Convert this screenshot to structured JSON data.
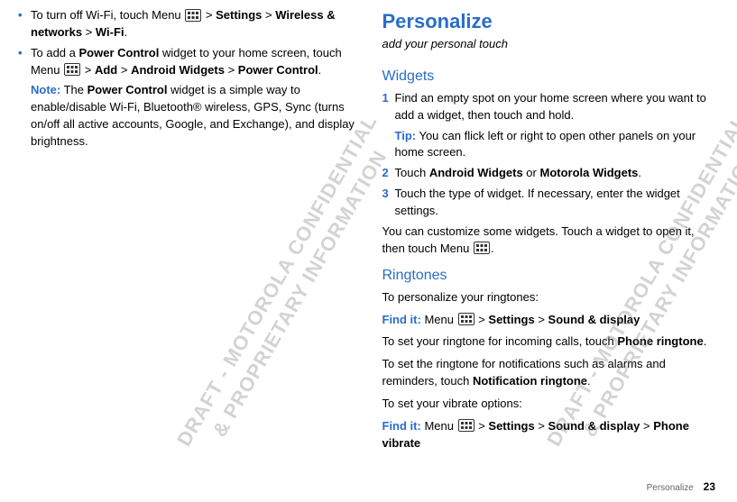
{
  "leftCol": {
    "b1_pre": "To turn off Wi-Fi, touch Menu ",
    "b1_mid1": " > ",
    "b1_s1": "Settings",
    "b1_mid2": " > ",
    "b1_s2": "Wireless & networks",
    "b1_mid3": " > ",
    "b1_s3": "Wi-Fi",
    "b1_post": ".",
    "b2_pre": "To add a ",
    "b2_s1": "Power Control",
    "b2_mid1": " widget to your home screen, touch Menu ",
    "b2_mid2": " > ",
    "b2_s2": "Add",
    "b2_mid3": " > ",
    "b2_s3": "Android Widgets",
    "b2_mid4": " > ",
    "b2_s4": "Power Control",
    "b2_post": ".",
    "noteLabel": "Note:",
    "note_pre": " The ",
    "note_s1": "Power Control",
    "note_post": " widget is a simple way to enable/disable Wi-Fi, Bluetooth® wireless, GPS, Sync (turns on/off all active accounts, Google, and Exchange), and display brightness."
  },
  "rightCol": {
    "title": "Personalize",
    "subtitle": "add your personal touch",
    "widgetsHeading": "Widgets",
    "w1": "Find an empty spot on your home screen where you want to add a widget, then touch and hold.",
    "w1TipLabel": "Tip:",
    "w1Tip": " You can flick left or right to open other panels on your home screen.",
    "w2_pre": "Touch ",
    "w2_s1": "Android Widgets",
    "w2_mid": " or ",
    "w2_s2": "Motorola Widgets",
    "w2_post": ".",
    "w3": "Touch the type of widget. If necessary, enter the widget settings.",
    "widgetsTail_pre": "You can customize some widgets. Touch a widget to open it, then touch Menu ",
    "widgetsTail_post": ".",
    "ringHeading": "Ringtones",
    "ringIntro": "To personalize your ringtones:",
    "findItLabel": "Find it:",
    "r1_pre": " Menu ",
    "r1_mid1": " > ",
    "r1_s1": "Settings",
    "r1_mid2": " > ",
    "r1_s2": "Sound & display",
    "r2_pre": "To set your ringtone for incoming calls, touch ",
    "r2_s1": "Phone ringtone",
    "r2_post": ".",
    "r3_pre": "To set the ringtone for notifications such as alarms and reminders, touch ",
    "r3_s1": "Notification ringtone",
    "r3_post": ".",
    "r4": "To set your vibrate options:",
    "r5_pre": " Menu ",
    "r5_mid1": " > ",
    "r5_s1": "Settings",
    "r5_mid2": " > ",
    "r5_s2": "Sound & display",
    "r5_mid3": " > ",
    "r5_s3": "Phone vibrate"
  },
  "footer": {
    "label": "Personalize",
    "page": "23"
  },
  "numbers": {
    "n1": "1",
    "n2": "2",
    "n3": "3"
  },
  "bulletMark": "•",
  "watermark": "DRAFT - MOTOROLA CONFIDENTIAL\n& PROPRIETARY INFORMATION"
}
